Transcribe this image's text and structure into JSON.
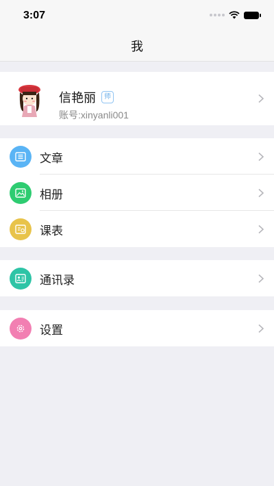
{
  "status_bar": {
    "time": "3:07"
  },
  "nav": {
    "title": "我"
  },
  "profile": {
    "name": "信艳丽",
    "badge": "师",
    "account": "账号:xinyanli001"
  },
  "menu": [
    {
      "label": "文章",
      "icon": "article-icon",
      "color": "#5ab4f5"
    },
    {
      "label": "相册",
      "icon": "photo-album-icon",
      "color": "#2ecc71"
    },
    {
      "label": "课表",
      "icon": "timetable-icon",
      "color": "#e8c34a"
    },
    {
      "label": "通讯录",
      "icon": "contacts-icon",
      "color": "#2ec4a6"
    },
    {
      "label": "设置",
      "icon": "gear-icon",
      "color": "#f27fb2"
    }
  ]
}
